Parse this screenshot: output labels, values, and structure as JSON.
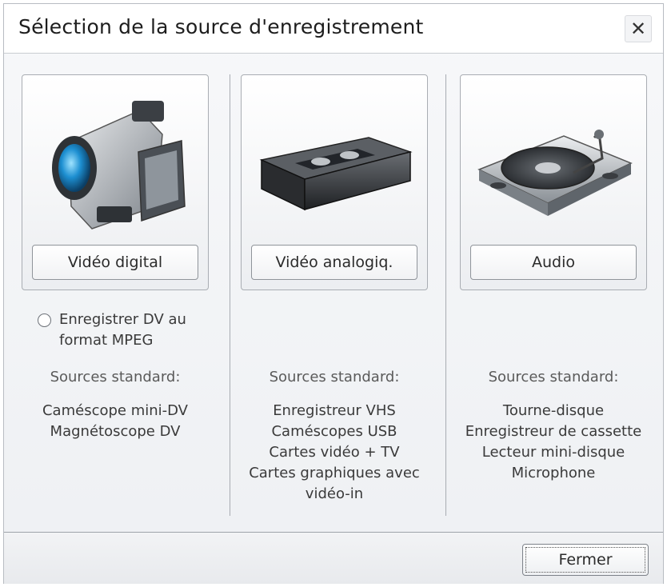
{
  "window": {
    "title": "Sélection de la source d'enregistrement",
    "close_glyph": "✕"
  },
  "columns": [
    {
      "icon": "camcorder-icon",
      "button_label": "Vidéo digital",
      "option_label": "Enregistrer DV au format MPEG",
      "option_checked": false,
      "heading": "Sources standard:",
      "sources": [
        "Caméscope mini-DV",
        "Magnétoscope DV"
      ]
    },
    {
      "icon": "vhs-cassette-icon",
      "button_label": "Vidéo analogiq.",
      "heading": "Sources standard:",
      "sources": [
        "Enregistreur VHS",
        "Caméscopes USB",
        "Cartes vidéo + TV",
        "Cartes graphiques avec",
        "vidéo-in"
      ]
    },
    {
      "icon": "turntable-icon",
      "button_label": "Audio",
      "heading": "Sources standard:",
      "sources": [
        "Tourne-disque",
        "Enregistreur de cassette",
        "Lecteur mini-disque",
        "Microphone"
      ]
    }
  ],
  "footer": {
    "close_label": "Fermer"
  }
}
